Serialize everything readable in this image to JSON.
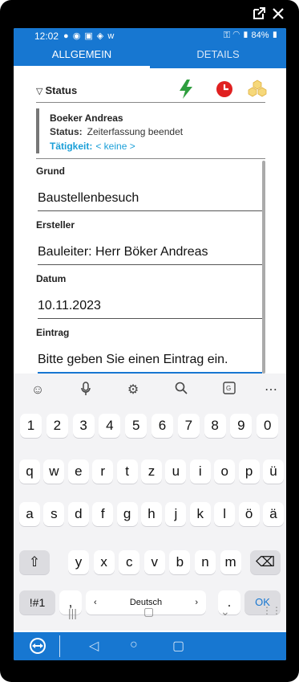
{
  "window": {
    "external_icon": "external-link-icon",
    "close_icon": "close-icon"
  },
  "statusbar": {
    "time": "12:02",
    "left_icons": "● ◉ ▣ ◈ w",
    "battery": "84%"
  },
  "tabs": [
    {
      "label": "ALLGEMEIN",
      "active": true
    },
    {
      "label": "DETAILS",
      "active": false
    }
  ],
  "status_section": {
    "toggle_glyph": "▽",
    "label": "Status",
    "name": "Boeker Andreas",
    "status_label": "Status:",
    "status_value": "Zeiterfassung beendet",
    "activity_label": "Tätigkeit:",
    "activity_value": "< keine >"
  },
  "fields": [
    {
      "label": "Grund",
      "value": "Baustellenbesuch"
    },
    {
      "label": "Ersteller",
      "value": "Bauleiter: Herr Böker Andreas"
    },
    {
      "label": "Datum",
      "value": "10.11.2023"
    },
    {
      "label": "Eintrag",
      "value": "Bitte geben Sie einen Eintrag ein."
    }
  ],
  "keyboard": {
    "number_row": [
      "1",
      "2",
      "3",
      "4",
      "5",
      "6",
      "7",
      "8",
      "9",
      "0"
    ],
    "row1": [
      "q",
      "w",
      "e",
      "r",
      "t",
      "z",
      "u",
      "i",
      "o",
      "p",
      "ü"
    ],
    "row2": [
      "a",
      "s",
      "d",
      "f",
      "g",
      "h",
      "j",
      "k",
      "l",
      "ö",
      "ä"
    ],
    "row3": [
      "y",
      "x",
      "c",
      "v",
      "b",
      "n",
      "m"
    ],
    "symbols_key": "!#1",
    "comma_key": ",",
    "space_label": "Deutsch",
    "period_key": ".",
    "ok_key": "OK",
    "shift_glyph": "⇧",
    "backspace_glyph": "⌫"
  },
  "colors": {
    "accent": "#1777d1",
    "bolt": "#2e9e3e",
    "clock": "#e02020",
    "cubes": "#f0c24a",
    "link": "#1a9fd8"
  }
}
